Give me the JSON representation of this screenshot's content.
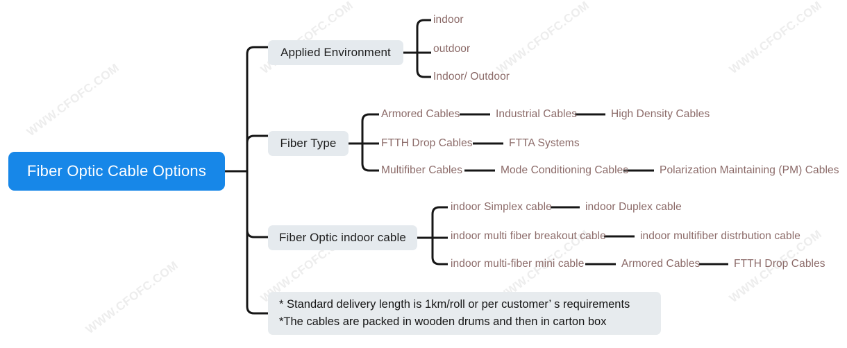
{
  "diagram": {
    "title": "Fiber Optic Cable Options",
    "colors": {
      "root_fill": "#1787e8",
      "root_text": "#ffffff",
      "branch_fill": "#e5eaee",
      "branch_text": "#1d1d1d",
      "leaf_text": "#8b6a68",
      "connector": "#161616",
      "watermark": "#ededed",
      "background": "#ffffff"
    },
    "watermark_text": "WWW.CFOFC.COM"
  },
  "root": {
    "label": "Fiber Optic Cable Options"
  },
  "branches": [
    {
      "label": "Applied Environment",
      "children": [
        {
          "chain": [
            "indoor"
          ]
        },
        {
          "chain": [
            "outdoor"
          ]
        },
        {
          "chain": [
            "Indoor/ Outdoor"
          ]
        }
      ]
    },
    {
      "label": "Fiber  Type",
      "children": [
        {
          "chain": [
            "Armored Cables",
            "Industrial Cables",
            "High Density Cables"
          ]
        },
        {
          "chain": [
            "FTTH  Drop Cables",
            "FTTA Systems"
          ]
        },
        {
          "chain": [
            "Multifiber Cables",
            "Mode Conditioning Cables",
            "Polarization Maintaining (PM) Cables"
          ]
        }
      ]
    },
    {
      "label": "Fiber Optic indoor cable",
      "children": [
        {
          "chain": [
            "indoor Simplex cable",
            "indoor Duplex cable"
          ]
        },
        {
          "chain": [
            "indoor multi fiber breakout cable",
            "indoor multifiber distrbution cable"
          ]
        },
        {
          "chain": [
            "indoor multi-fiber mini cable",
            "Armored Cables",
            "FTTH  Drop Cables"
          ]
        }
      ]
    }
  ],
  "note": {
    "line1": "* Standard delivery length is 1km/roll or per customer’  s requirements",
    "line2": "*The cables are packed in wooden drums and then in carton box"
  }
}
